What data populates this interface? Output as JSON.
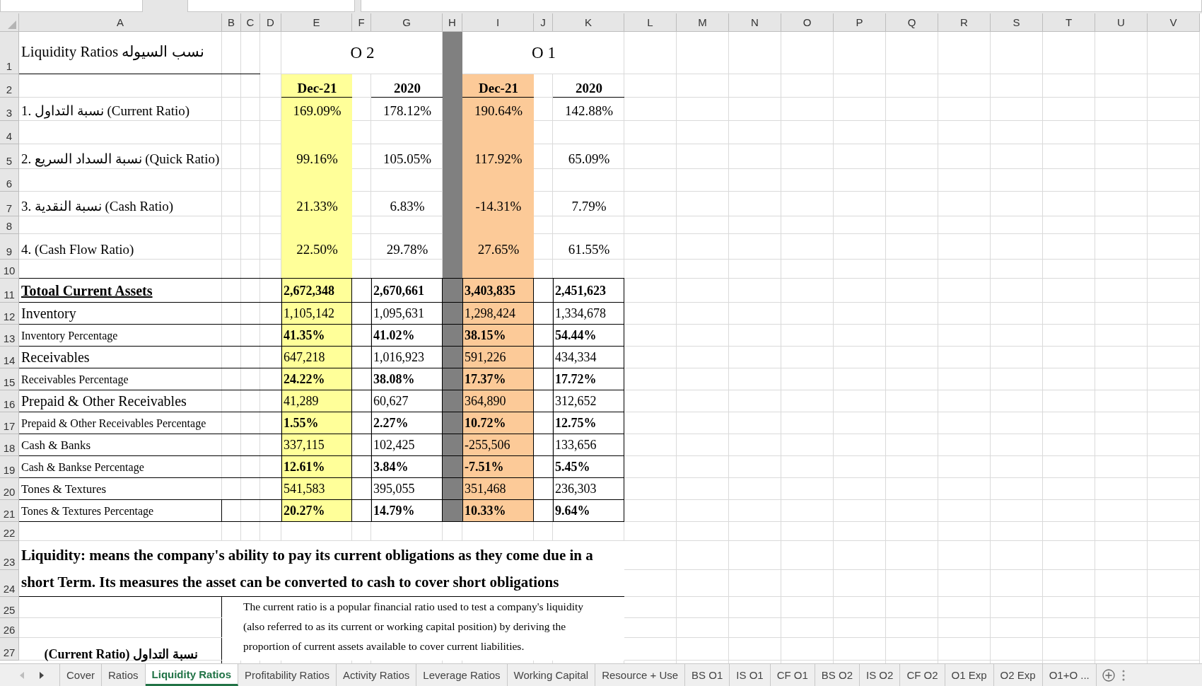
{
  "column_headers": [
    "A",
    "B",
    "C",
    "D",
    "E",
    "F",
    "G",
    "H",
    "I",
    "J",
    "K",
    "L",
    "M",
    "N",
    "O",
    "P",
    "Q",
    "R",
    "S",
    "T",
    "U",
    "V"
  ],
  "row_headers": [
    "1",
    "2",
    "3",
    "4",
    "5",
    "6",
    "7",
    "8",
    "9",
    "10",
    "11",
    "12",
    "13",
    "14",
    "15",
    "16",
    "17",
    "18",
    "19",
    "20",
    "21",
    "22",
    "23",
    "24",
    "25",
    "26",
    "27"
  ],
  "title": "Liquidity Ratios نسب السيوله",
  "groups": [
    {
      "label": "O 2"
    },
    {
      "label": "O 1"
    }
  ],
  "periods": [
    {
      "label": "Dec-21",
      "color": "#ffff99"
    },
    {
      "label": "2020"
    },
    {
      "label": "Dec-21",
      "color": "#fcca98"
    },
    {
      "label": "2020"
    }
  ],
  "ratios": [
    {
      "label": "1. نسبة التداول (Current Ratio)",
      "values": [
        "169.09%",
        "178.12%",
        "190.64%",
        "142.88%"
      ]
    },
    {
      "label": "2. نسبة السداد السريع (Quick Ratio)",
      "values": [
        "99.16%",
        "105.05%",
        "117.92%",
        "65.09%"
      ]
    },
    {
      "label": "3. نسبة النقدية (Cash Ratio)",
      "values": [
        "21.33%",
        "6.83%",
        "-14.31%",
        "7.79%"
      ]
    },
    {
      "label": "4. (Cash Flow Ratio)",
      "values": [
        "22.50%",
        "29.78%",
        "27.65%",
        "61.55%"
      ]
    }
  ],
  "assets": [
    {
      "label": "Totoal Current Assets",
      "kind": "total",
      "values": [
        "2,672,348",
        "2,670,661",
        "3,403,835",
        "2,451,623"
      ]
    },
    {
      "label": "Inventory",
      "kind": "amount",
      "values": [
        "1,105,142",
        "1,095,631",
        "1,298,424",
        "1,334,678"
      ]
    },
    {
      "label": "Inventory Percentage",
      "kind": "percentage",
      "values": [
        "41.35%",
        "41.02%",
        "38.15%",
        "54.44%"
      ]
    },
    {
      "label": "Receivables",
      "kind": "amount",
      "values": [
        "647,218",
        "1,016,923",
        "591,226",
        "434,334"
      ]
    },
    {
      "label": "Receivables Percentage",
      "kind": "percentage",
      "values": [
        "24.22%",
        "38.08%",
        "17.37%",
        "17.72%"
      ]
    },
    {
      "label": "Prepaid & Other Receivables",
      "kind": "amount",
      "values": [
        "41,289",
        "60,627",
        "364,890",
        "312,652"
      ]
    },
    {
      "label": "Prepaid & Other Receivables Percentage",
      "kind": "percentage",
      "values": [
        "1.55%",
        "2.27%",
        "10.72%",
        "12.75%"
      ]
    },
    {
      "label": "Cash & Banks",
      "kind": "minor",
      "values": [
        "337,115",
        "102,425",
        "-255,506",
        "133,656"
      ]
    },
    {
      "label": "Cash & Bankse Percentage",
      "kind": "percentage",
      "values": [
        "12.61%",
        "3.84%",
        "-7.51%",
        "5.45%"
      ]
    },
    {
      "label": "Tones & Textures",
      "kind": "minor",
      "values": [
        "541,583",
        "395,055",
        "351,468",
        "236,303"
      ]
    },
    {
      "label": "Tones & Textures Percentage",
      "kind": "percentage",
      "values": [
        "20.27%",
        "14.79%",
        "10.33%",
        "9.64%"
      ]
    }
  ],
  "definition": "Liquidity: means the company's ability to pay its current obligations as they come due in a short Term. Its measures the asset can be converted to cash to cover short obligations",
  "explanation_label": "(Current Ratio) نسبة التداول",
  "explanation": "The current ratio is a popular financial ratio used to test a company's liquidity (also referred to as its current or working capital position) by deriving the proportion of current assets available to cover current liabilities.",
  "sheet_tabs": [
    {
      "label": "Cover",
      "selected": false
    },
    {
      "label": "Ratios",
      "selected": false
    },
    {
      "label": "Liquidity Ratios",
      "selected": true
    },
    {
      "label": "Profitability Ratios",
      "selected": false
    },
    {
      "label": "Activity Ratios",
      "selected": false
    },
    {
      "label": "Leverage Ratios",
      "selected": false
    },
    {
      "label": "Working Capital",
      "selected": false
    },
    {
      "label": "Resource + Use",
      "selected": false
    },
    {
      "label": "BS O1",
      "selected": false
    },
    {
      "label": "IS O1",
      "selected": false
    },
    {
      "label": "CF O1",
      "selected": false
    },
    {
      "label": "BS O2",
      "selected": false
    },
    {
      "label": "IS O2",
      "selected": false
    },
    {
      "label": "CF O2",
      "selected": false
    },
    {
      "label": "O1 Exp",
      "selected": false
    },
    {
      "label": "O2 Exp",
      "selected": false
    },
    {
      "label": "O1+O ...",
      "selected": false
    }
  ]
}
